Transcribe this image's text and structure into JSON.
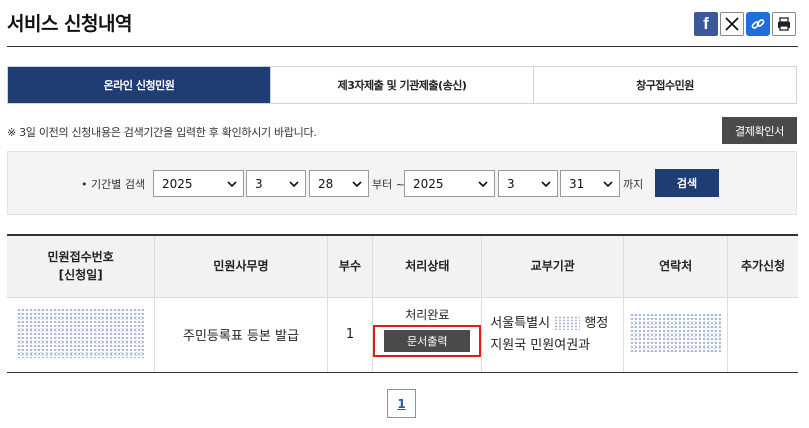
{
  "page": {
    "title": "서비스 신청내역"
  },
  "share": {
    "facebook_glyph": "f"
  },
  "tabs": [
    {
      "label": "온라인 신청민원",
      "active": true
    },
    {
      "label": "제3자제출 및 기관제출(송신)",
      "active": false
    },
    {
      "label": "창구접수민원",
      "active": false
    }
  ],
  "notice": "※ 3일 이전의 신청내용은 검색기간을 입력한 후 확인하시기 바랍니다.",
  "payment_receipt_label": "결제확인서",
  "search": {
    "label": "• 기간별 검색",
    "from": {
      "year": "2025",
      "month": "3",
      "day": "28"
    },
    "from_suffix": "부터 ~",
    "to": {
      "year": "2025",
      "month": "3",
      "day": "31"
    },
    "to_suffix": "까지",
    "button_label": "검색"
  },
  "table": {
    "headers": {
      "receipt_no": "민원접수번호",
      "receipt_date": "[신청일]",
      "affair_name": "민원사무명",
      "copies": "부수",
      "status": "처리상태",
      "issuing_agency": "교부기관",
      "contact": "연락처",
      "extra_request": "추가신청"
    },
    "rows": [
      {
        "affair_name": "주민등록표 등본 발급",
        "copies": "1",
        "status": "처리완료",
        "print_label": "문서출력",
        "agency_line1_prefix": "서울특별시",
        "agency_line1_suffix": "행정",
        "agency_line2": "지원국 민원여권과"
      }
    ]
  },
  "pagination": {
    "current": "1"
  },
  "colors": {
    "primary_navy": "#1f3d72",
    "dark_button": "#4a4a4a",
    "highlight_red": "#e31b1b",
    "pager_blue": "#5aa0d6"
  }
}
